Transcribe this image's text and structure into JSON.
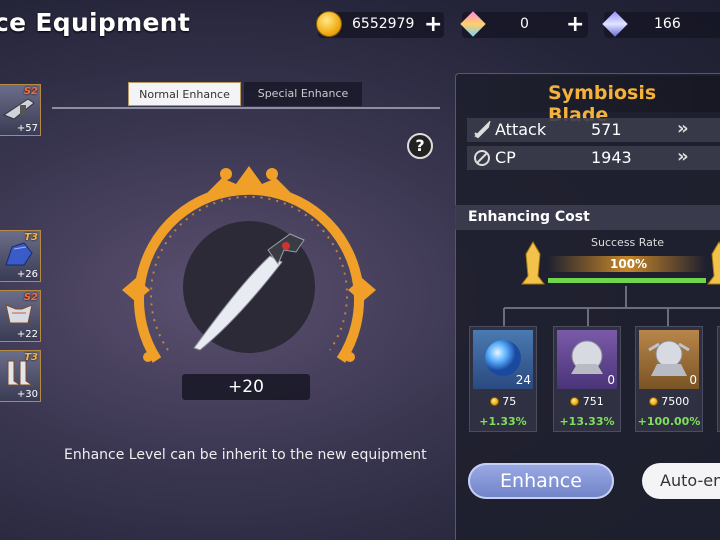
{
  "header": {
    "title": "ce Equipment"
  },
  "currencies": [
    {
      "icon": "gold-coin-icon",
      "value": "6552979"
    },
    {
      "icon": "pink-crystal-icon",
      "value": "0"
    },
    {
      "icon": "blue-crystal-icon",
      "value": "166"
    }
  ],
  "equipment_slots": [
    {
      "tier": "S2",
      "level": "+57",
      "icon": "gun-icon"
    },
    {
      "tier": "T3",
      "level": "+26",
      "icon": "gauntlet-icon"
    },
    {
      "tier": "S2",
      "level": "+22",
      "icon": "chest-armor-icon"
    },
    {
      "tier": "T3",
      "level": "+30",
      "icon": "boots-icon"
    }
  ],
  "tabs": {
    "normal": "Normal Enhance",
    "special": "Special Enhance"
  },
  "help": "?",
  "weapon": {
    "enhance_level": "+20"
  },
  "note": "Enhance Level can be inherit to the new equipment",
  "item": {
    "name": "Symbiosis Blade",
    "stats": [
      {
        "label": "Attack",
        "value": "571"
      },
      {
        "label": "CP",
        "value": "1943"
      }
    ]
  },
  "enhancing_cost": {
    "title": "Enhancing Cost",
    "success_rate_label": "Success Rate",
    "success_rate": "100%",
    "success_rate_fraction": 1.0,
    "materials": [
      {
        "count": "24",
        "cost": "75",
        "bonus": "+1.33%"
      },
      {
        "count": "0",
        "cost": "751",
        "bonus": "+13.33%"
      },
      {
        "count": "0",
        "cost": "7500",
        "bonus": "+100.00%"
      }
    ]
  },
  "buttons": {
    "enhance": "Enhance",
    "auto": "Auto-en"
  },
  "colors": {
    "accent": "#f0a028",
    "success": "#6fd64b",
    "enhance_button": "#8a9bd8"
  }
}
